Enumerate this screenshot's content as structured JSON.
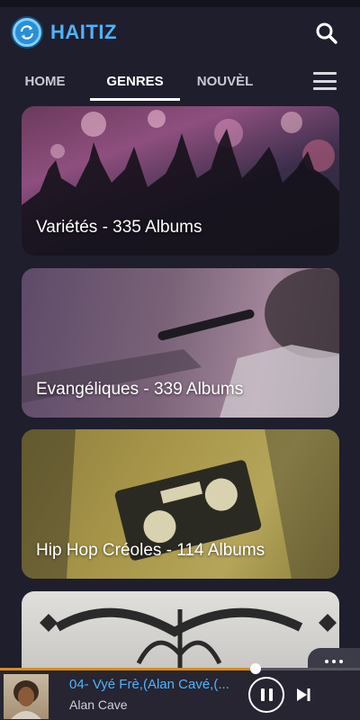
{
  "app": {
    "title": "HAITIZ",
    "logo_icon": "refresh-globe-icon",
    "accent_color": "#4fb3ff"
  },
  "header": {
    "search_icon": "search-icon"
  },
  "tabs": [
    {
      "label": "HOME",
      "active": false
    },
    {
      "label": "GENRES",
      "active": true
    },
    {
      "label": "NOUVÈL",
      "active": false
    }
  ],
  "menu_icon": "hamburger-menu-icon",
  "genres": [
    {
      "label": "Variétés - 335 Albums"
    },
    {
      "label": "Evangéliques - 339 Albums"
    },
    {
      "label": "Hip Hop Créoles - 114 Albums"
    },
    {
      "label": ""
    }
  ],
  "more_icon": "more-horizontal-icon",
  "player": {
    "track_title": "04- Vyé Frè,(Alan Cavé,(...",
    "artist": "Alan Cave",
    "progress_percent": 71,
    "progress_color": "#d98a1a",
    "pause_icon": "pause-icon",
    "next_icon": "skip-next-icon"
  }
}
